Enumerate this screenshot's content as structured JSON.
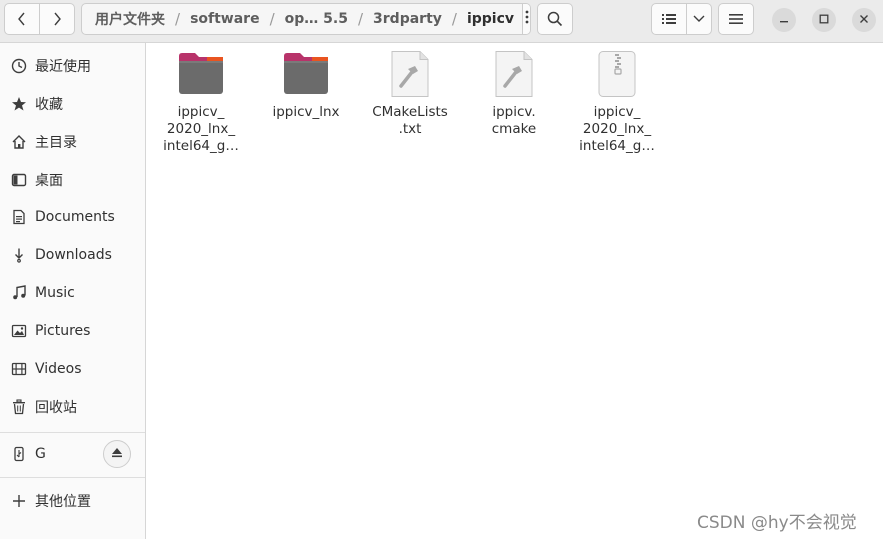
{
  "toolbar": {
    "breadcrumbs": [
      "用户文件夹",
      "software",
      "op… 5.5",
      "3rdparty",
      "ippicv"
    ]
  },
  "sidebar": {
    "items": [
      {
        "label": "最近使用",
        "icon": "clock-icon"
      },
      {
        "label": "收藏",
        "icon": "star-icon"
      },
      {
        "label": "主目录",
        "icon": "home-icon"
      },
      {
        "label": "桌面",
        "icon": "desktop-icon"
      },
      {
        "label": "Documents",
        "icon": "document-icon"
      },
      {
        "label": "Downloads",
        "icon": "download-icon"
      },
      {
        "label": "Music",
        "icon": "music-icon"
      },
      {
        "label": "Pictures",
        "icon": "picture-icon"
      },
      {
        "label": "Videos",
        "icon": "video-icon"
      },
      {
        "label": "回收站",
        "icon": "trash-icon"
      }
    ],
    "devices": [
      {
        "label": "G",
        "icon": "usb-drive-icon"
      }
    ],
    "other": {
      "label": "其他位置",
      "icon": "plus-icon"
    }
  },
  "files": [
    {
      "name": "ippicv_\n2020_lnx_\nintel64_g…",
      "type": "folder",
      "icon": "folder-icon"
    },
    {
      "name": "ippicv_lnx",
      "type": "folder",
      "icon": "folder-icon"
    },
    {
      "name": "CMakeLists\n.txt",
      "type": "file",
      "icon": "build-file-icon"
    },
    {
      "name": "ippicv.\ncmake",
      "type": "file",
      "icon": "build-file-icon"
    },
    {
      "name": "ippicv_\n2020_lnx_\nintel64_g…",
      "type": "archive",
      "icon": "archive-icon"
    }
  ],
  "watermark": "CSDN @hy不会视觉",
  "colors": {
    "folder_body": "#6b6b6b",
    "folder_tab": "#b8336a",
    "folder_accent": "#e95420"
  }
}
